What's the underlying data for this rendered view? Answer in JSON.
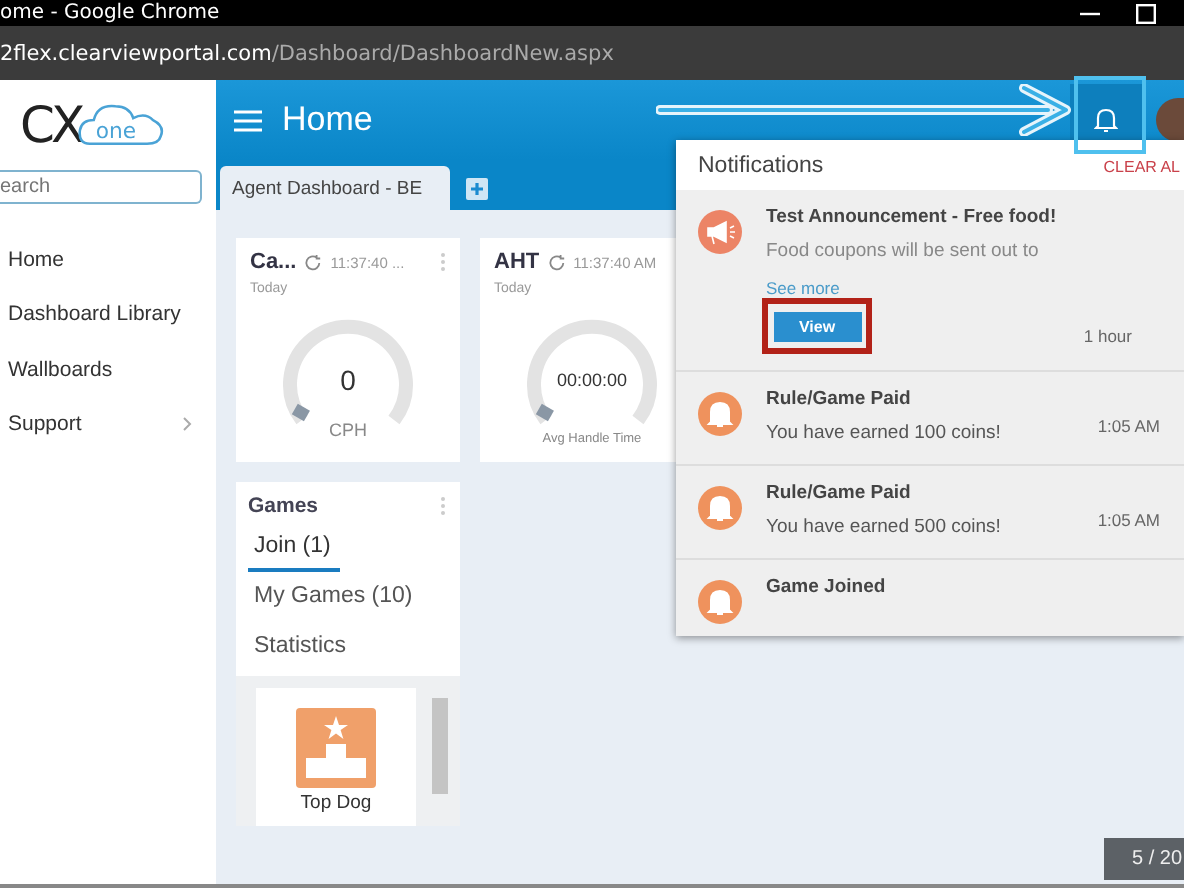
{
  "browser": {
    "title": "ome - Google Chrome",
    "url_host": "2flex.clearviewportal.com",
    "url_path": "/Dashboard/DashboardNew.aspx"
  },
  "logo": {
    "mark": "CX",
    "cloud": "one"
  },
  "sidebar": {
    "search": {
      "placeholder": "earch"
    },
    "items": [
      {
        "label": "Home",
        "submenu": false
      },
      {
        "label": "Dashboard Library",
        "submenu": false
      },
      {
        "label": "Wallboards",
        "submenu": false
      },
      {
        "label": "Support",
        "submenu": true
      }
    ]
  },
  "header": {
    "title": "Home"
  },
  "tabs": [
    {
      "label": "Agent Dashboard - BE",
      "selected": true
    }
  ],
  "widgets": [
    {
      "title": "Ca...",
      "time": "11:37:40 ...",
      "period": "Today",
      "value": "0",
      "caption": "CPH",
      "menu": true
    },
    {
      "title": "AHT",
      "time": "11:37:40 AM",
      "period": "Today",
      "value": "00:00:00",
      "caption": "Avg Handle Time"
    }
  ],
  "games": {
    "title": "Games",
    "tabs": [
      {
        "label": "Join (1)",
        "selected": true
      },
      {
        "label": "My Games (10)",
        "selected": false
      },
      {
        "label": "Statistics",
        "selected": false
      }
    ],
    "cards": [
      {
        "label": "Top Dog"
      }
    ]
  },
  "notifications": {
    "title": "Notifications",
    "clear": "CLEAR AL",
    "items": [
      {
        "kind": "announcement",
        "title": "Test Announcement - Free food!",
        "body": "Food coupons will be sent out to",
        "link": "See more",
        "button": "View",
        "time": "1 hour"
      },
      {
        "kind": "bell",
        "title": "Rule/Game Paid",
        "body": "You have earned 100 coins!",
        "time": "1:05 AM"
      },
      {
        "kind": "bell",
        "title": "Rule/Game Paid",
        "body": "You have earned 500 coins!",
        "time": "1:05 AM"
      },
      {
        "kind": "bell",
        "title": "Game Joined"
      }
    ]
  },
  "page_counter": "5 / 20"
}
